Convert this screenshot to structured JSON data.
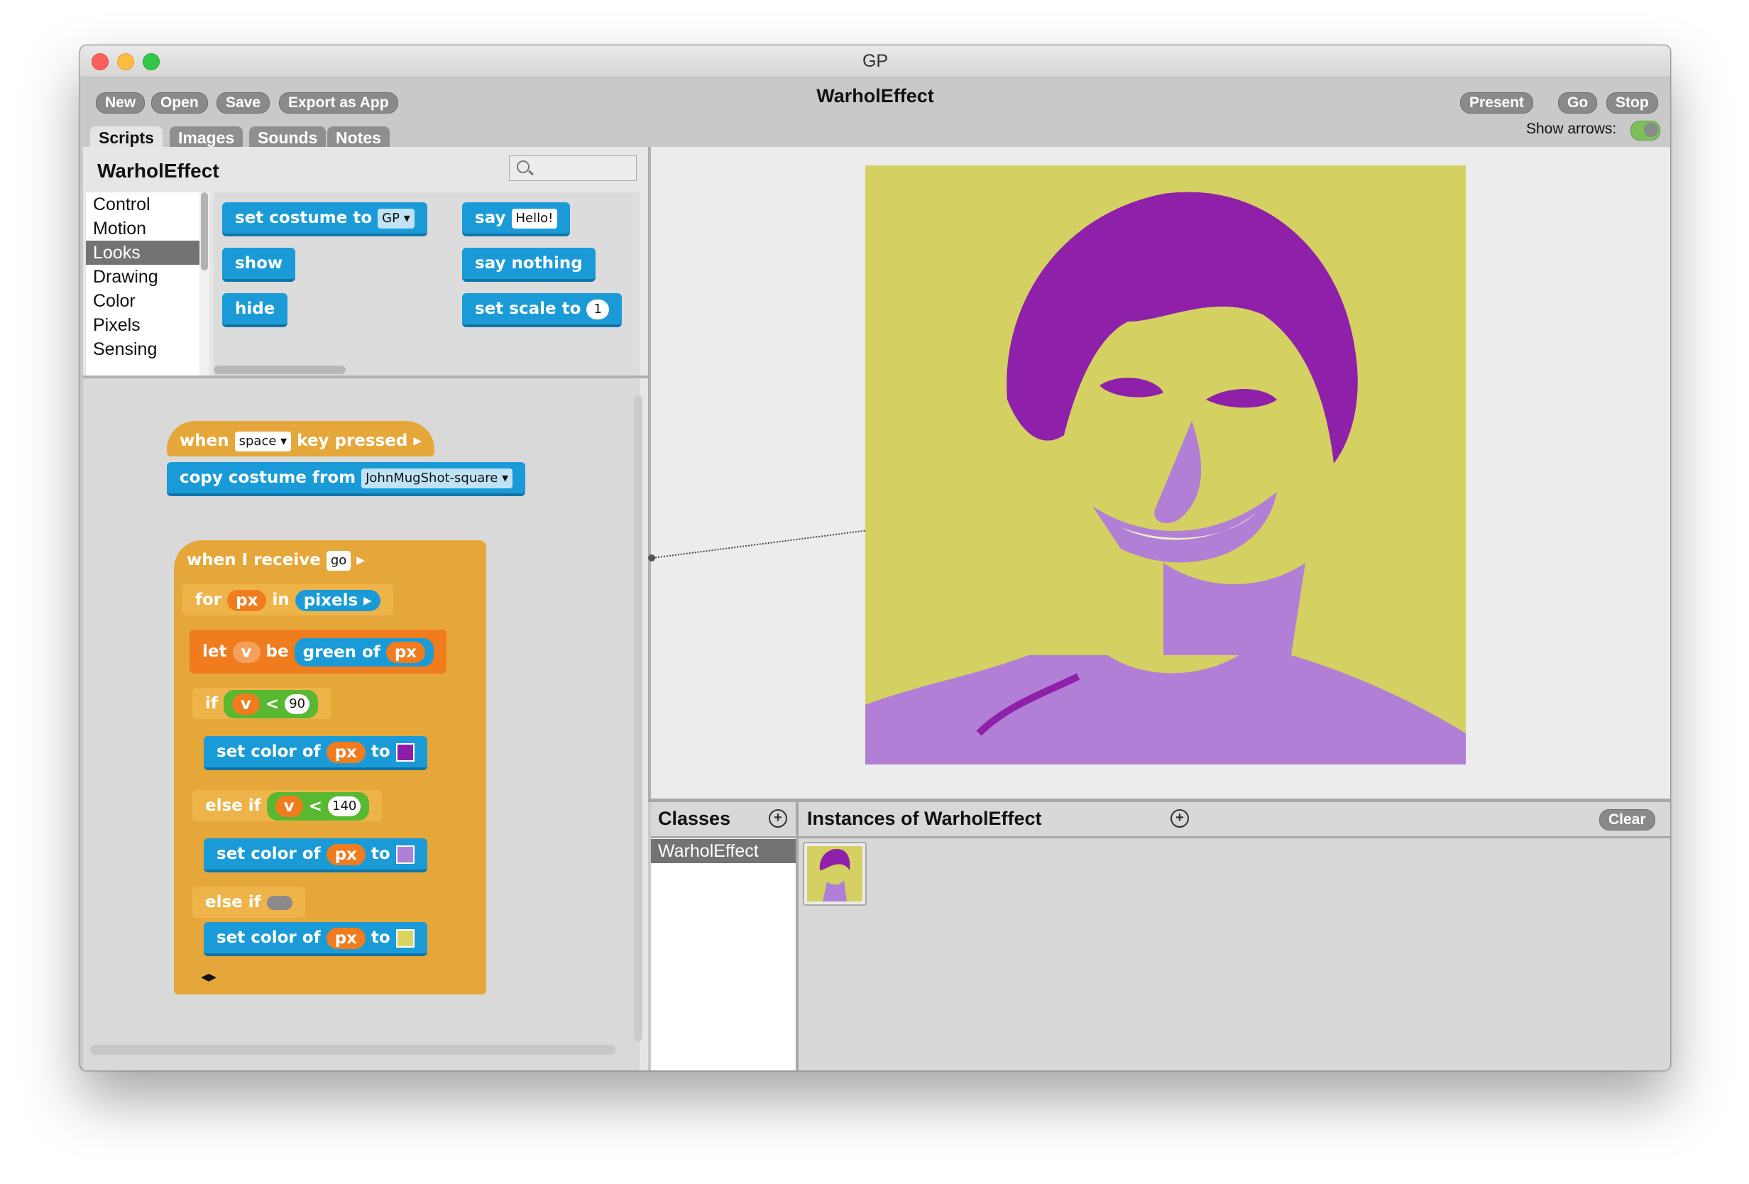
{
  "window": {
    "title": "GP",
    "project_title": "WarholEffect"
  },
  "toolbar": {
    "new": "New",
    "open": "Open",
    "save": "Save",
    "export": "Export as App",
    "present": "Present",
    "go": "Go",
    "stop": "Stop",
    "show_arrows": "Show arrows:"
  },
  "tabs": [
    "Scripts",
    "Images",
    "Sounds",
    "Notes"
  ],
  "class_panel": {
    "title": "WarholEffect",
    "search_placeholder": ""
  },
  "categories": [
    "Control",
    "Motion",
    "Looks",
    "Drawing",
    "Color",
    "Pixels",
    "Sensing"
  ],
  "selected_category": "Looks",
  "palette": {
    "set_costume": "set costume to",
    "costume_value": "GP",
    "say": "say",
    "say_value": "Hello!",
    "show": "show",
    "say_nothing": "say nothing",
    "hide": "hide",
    "set_scale": "set scale to",
    "scale_value": "1"
  },
  "script1": {
    "when": "when",
    "key": "space",
    "key_pressed": "key pressed",
    "copy_costume": "copy costume from",
    "costume_src": "JohnMugShot-square"
  },
  "script2": {
    "when_receive": "when I receive",
    "msg": "go",
    "for": "for",
    "px": "px",
    "in": "in",
    "pixels": "pixels",
    "let": "let",
    "v": "v",
    "be": "be",
    "green_of": "green of",
    "if": "if",
    "lt": "<",
    "n1": "90",
    "set_color": "set color of",
    "to": "to",
    "else_if": "else if",
    "n2": "140"
  },
  "colors": {
    "swatch1": "#8b1fa8",
    "swatch2": "#b07fd8",
    "swatch3": "#d8d562",
    "dark_purple": "#8f20aa",
    "light_purple": "#b27fd6",
    "yellow": "#d4d062"
  },
  "classes": {
    "title": "Classes",
    "items": [
      "WarholEffect"
    ]
  },
  "instances": {
    "title": "Instances of WarholEffect",
    "clear": "Clear"
  }
}
